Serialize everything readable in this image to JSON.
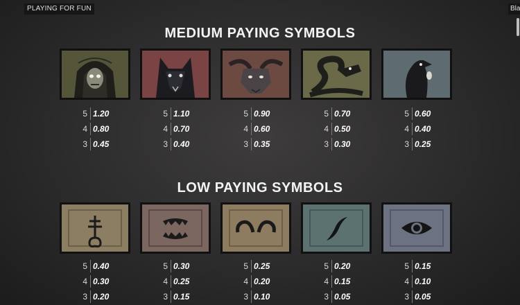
{
  "topbar": {
    "mode_label": "PLAYING FOR FUN",
    "right_label": "Bla"
  },
  "medium": {
    "title": "MEDIUM PAYING SYMBOLS",
    "symbols": [
      {
        "icon": "hooded-skull-icon",
        "pays": [
          {
            "count": "5",
            "value": "1.20"
          },
          {
            "count": "4",
            "value": "0.80"
          },
          {
            "count": "3",
            "value": "0.45"
          }
        ]
      },
      {
        "icon": "wolf-icon",
        "pays": [
          {
            "count": "5",
            "value": "1.10"
          },
          {
            "count": "4",
            "value": "0.70"
          },
          {
            "count": "3",
            "value": "0.40"
          }
        ]
      },
      {
        "icon": "goat-icon",
        "pays": [
          {
            "count": "5",
            "value": "0.90"
          },
          {
            "count": "4",
            "value": "0.60"
          },
          {
            "count": "3",
            "value": "0.35"
          }
        ]
      },
      {
        "icon": "serpent-icon",
        "pays": [
          {
            "count": "5",
            "value": "0.70"
          },
          {
            "count": "4",
            "value": "0.50"
          },
          {
            "count": "3",
            "value": "0.30"
          }
        ]
      },
      {
        "icon": "raven-icon",
        "pays": [
          {
            "count": "5",
            "value": "0.60"
          },
          {
            "count": "4",
            "value": "0.40"
          },
          {
            "count": "3",
            "value": "0.25"
          }
        ]
      }
    ]
  },
  "low": {
    "title": "LOW PAYING SYMBOLS",
    "symbols": [
      {
        "icon": "leviathan-cross-icon",
        "pays": [
          {
            "count": "5",
            "value": "0.40"
          },
          {
            "count": "4",
            "value": "0.30"
          },
          {
            "count": "3",
            "value": "0.20"
          }
        ]
      },
      {
        "icon": "fangs-icon",
        "pays": [
          {
            "count": "5",
            "value": "0.30"
          },
          {
            "count": "4",
            "value": "0.25"
          },
          {
            "count": "3",
            "value": "0.15"
          }
        ]
      },
      {
        "icon": "horns-icon",
        "pays": [
          {
            "count": "5",
            "value": "0.25"
          },
          {
            "count": "4",
            "value": "0.20"
          },
          {
            "count": "3",
            "value": "0.10"
          }
        ]
      },
      {
        "icon": "claw-mark-icon",
        "pays": [
          {
            "count": "5",
            "value": "0.20"
          },
          {
            "count": "4",
            "value": "0.15"
          },
          {
            "count": "3",
            "value": "0.05"
          }
        ]
      },
      {
        "icon": "eye-icon",
        "pays": [
          {
            "count": "5",
            "value": "0.15"
          },
          {
            "count": "4",
            "value": "0.10"
          },
          {
            "count": "3",
            "value": "0.05"
          }
        ]
      }
    ]
  },
  "colors": {
    "medium_backgrounds": [
      "#5a5a3a",
      "#7a4444",
      "#6c4a42",
      "#6a6a48",
      "#5e6c72"
    ],
    "low_backgrounds": [
      "#8c7e62",
      "#7c6660",
      "#8e7c60",
      "#5c7270",
      "#6c7282"
    ]
  }
}
